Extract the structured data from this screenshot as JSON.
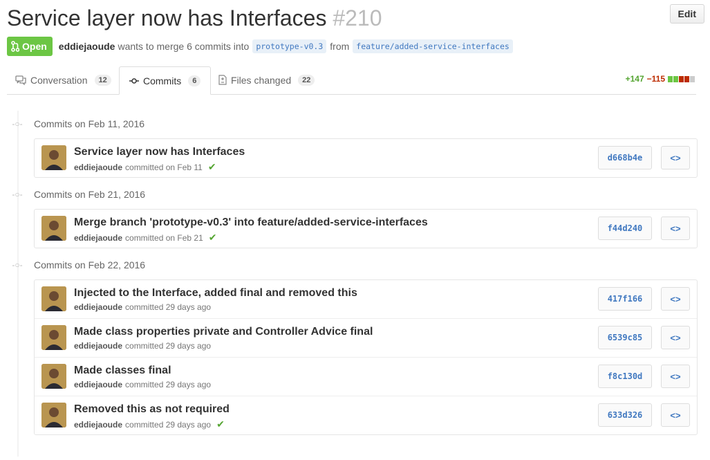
{
  "pr": {
    "title": "Service layer now has Interfaces",
    "number": "#210",
    "edit_label": "Edit",
    "state": "Open",
    "author": "eddiejaoude",
    "merge_text": "wants to merge 6 commits into",
    "base_ref": "prototype-v0.3",
    "from_text": "from",
    "head_ref": "feature/added-service-interfaces"
  },
  "tabs": [
    {
      "label": "Conversation",
      "count": "12"
    },
    {
      "label": "Commits",
      "count": "6"
    },
    {
      "label": "Files changed",
      "count": "22"
    }
  ],
  "diffstat": {
    "additions": "+147",
    "deletions": "−115"
  },
  "colors": {
    "open_green": "#6cc644",
    "link_blue": "#4078c0",
    "add_green": "#55a532",
    "del_red": "#bd2c00"
  },
  "groups": [
    {
      "heading": "Commits on Feb 11, 2016",
      "commits": [
        {
          "message": "Service layer now has Interfaces",
          "author": "eddiejaoude",
          "when": "committed on Feb 11",
          "check": "✔",
          "sha": "d668b4e"
        }
      ]
    },
    {
      "heading": "Commits on Feb 21, 2016",
      "commits": [
        {
          "message": "Merge branch 'prototype-v0.3' into feature/added-service-interfaces",
          "author": "eddiejaoude",
          "when": "committed on Feb 21",
          "check": "✔",
          "sha": "f44d240"
        }
      ]
    },
    {
      "heading": "Commits on Feb 22, 2016",
      "commits": [
        {
          "message": "Injected to the Interface, added final and removed this",
          "author": "eddiejaoude",
          "when": "committed 29 days ago",
          "check": "",
          "sha": "417f166"
        },
        {
          "message": "Made class properties private and Controller Advice final",
          "author": "eddiejaoude",
          "when": "committed 29 days ago",
          "check": "",
          "sha": "6539c85"
        },
        {
          "message": "Made classes final",
          "author": "eddiejaoude",
          "when": "committed 29 days ago",
          "check": "",
          "sha": "f8c130d"
        },
        {
          "message": "Removed this as not required",
          "author": "eddiejaoude",
          "when": "committed 29 days ago",
          "check": "✔",
          "sha": "633d326"
        }
      ]
    }
  ]
}
